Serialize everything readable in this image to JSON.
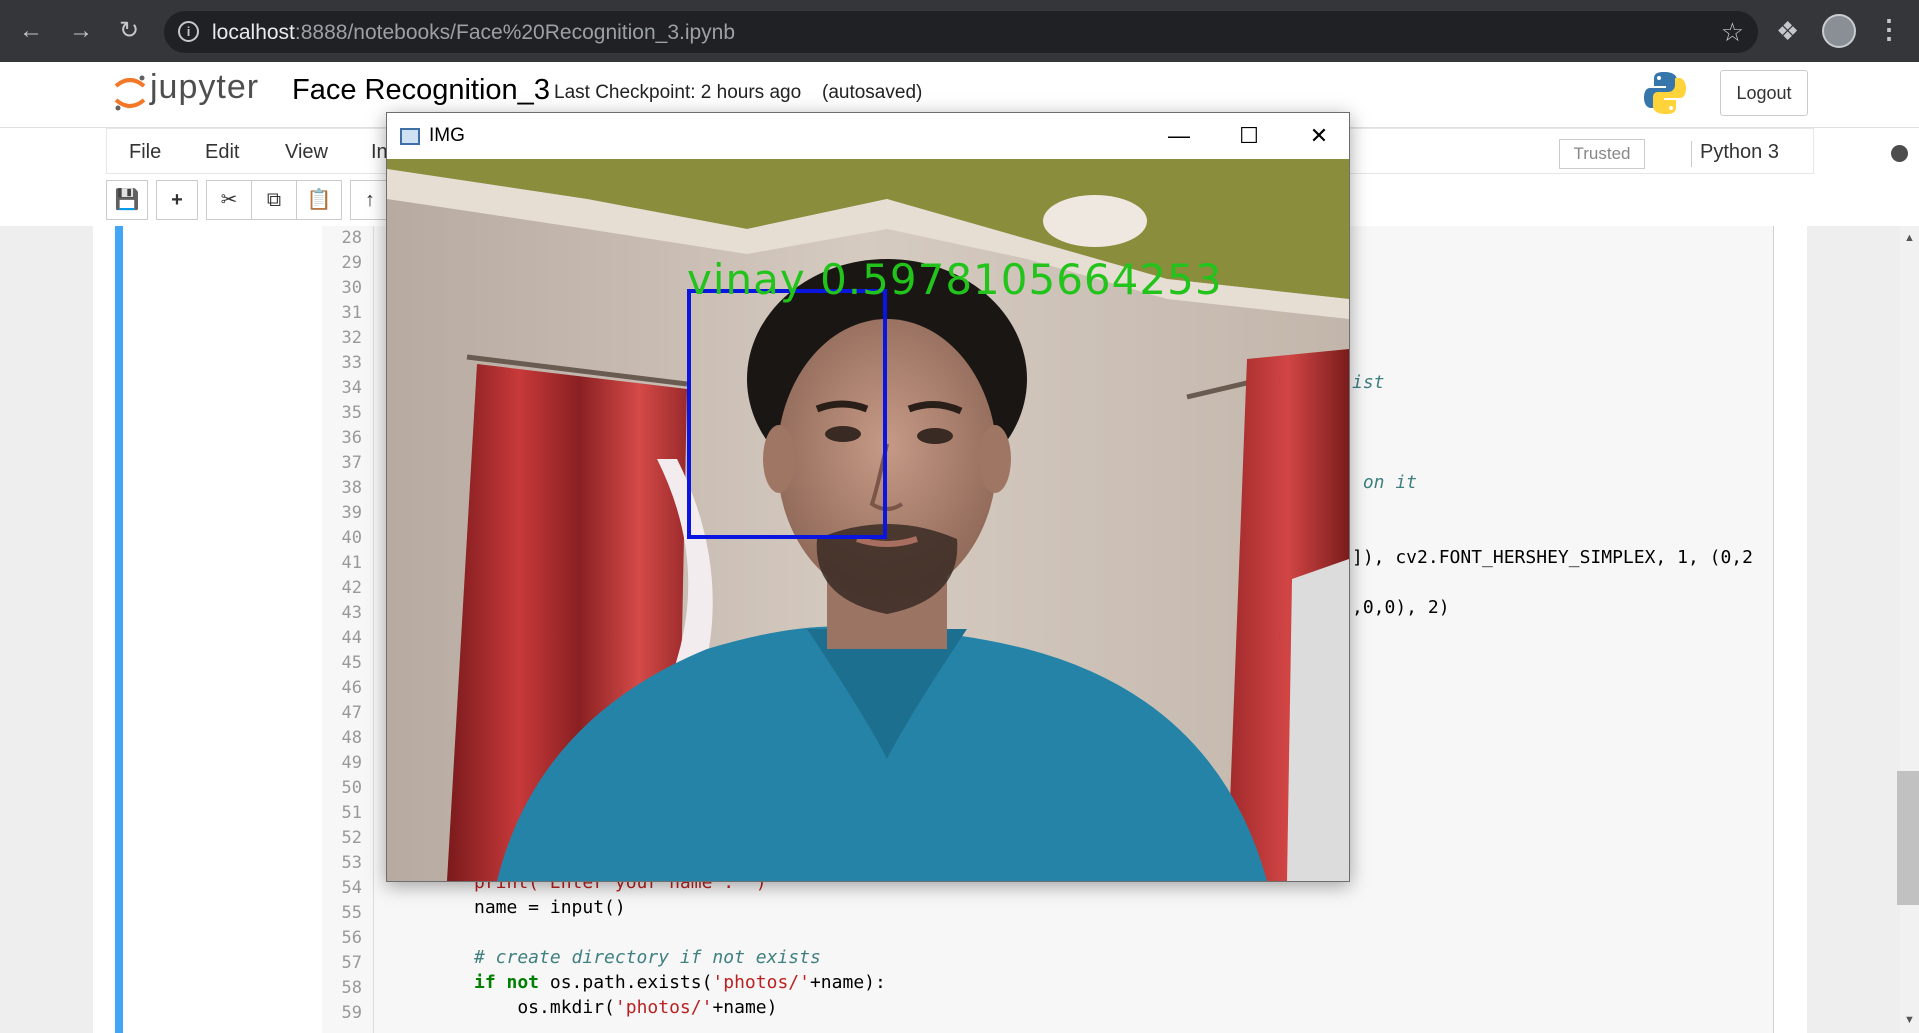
{
  "browser": {
    "url_host": "localhost",
    "url_rest": ":8888/notebooks/Face%20Recognition_3.ipynb"
  },
  "header": {
    "logo_text": "jupyter",
    "notebook_name": "Face Recognition_3",
    "checkpoint": "Last Checkpoint: 2 hours ago",
    "autosave": "(autosaved)",
    "logout_label": "Logout"
  },
  "menu": {
    "items": [
      "File",
      "Edit",
      "View",
      "In"
    ],
    "trusted_label": "Trusted",
    "kernel_name": "Python 3"
  },
  "toolbar": {
    "add_label": "+"
  },
  "code": {
    "line_numbers": [
      "28",
      "29",
      "30",
      "31",
      "32",
      "33",
      "34",
      "35",
      "36",
      "37",
      "38",
      "39",
      "40",
      "41",
      "42",
      "43",
      "44",
      "45",
      "46",
      "47",
      "48",
      "49",
      "50",
      "51",
      "52",
      "53",
      "54",
      "55",
      "56",
      "57",
      "58",
      "59"
    ],
    "frag_34": "ist",
    "frag_38": " on it",
    "frag_41": "]), cv2.FONT_HERSHEY_SIMPLEX, 1, (0,2",
    "frag_43": ",0,0), 2)",
    "line_54": "print('Enter your name : ')",
    "line_55": "name = input()",
    "line_57": "# create directory if not exists",
    "line_58_a": "if not",
    "line_58_b": " os.path.exists(",
    "line_58_c": "'photos/'",
    "line_58_d": "+name):",
    "line_59_a": "    os.mkdir(",
    "line_59_b": "'photos/'",
    "line_59_c": "+name)"
  },
  "cv_window": {
    "title": "IMG",
    "label_text": "vinay 0.5978105664253",
    "label_color": "#22c41c",
    "box_color": "#0a16e0"
  }
}
